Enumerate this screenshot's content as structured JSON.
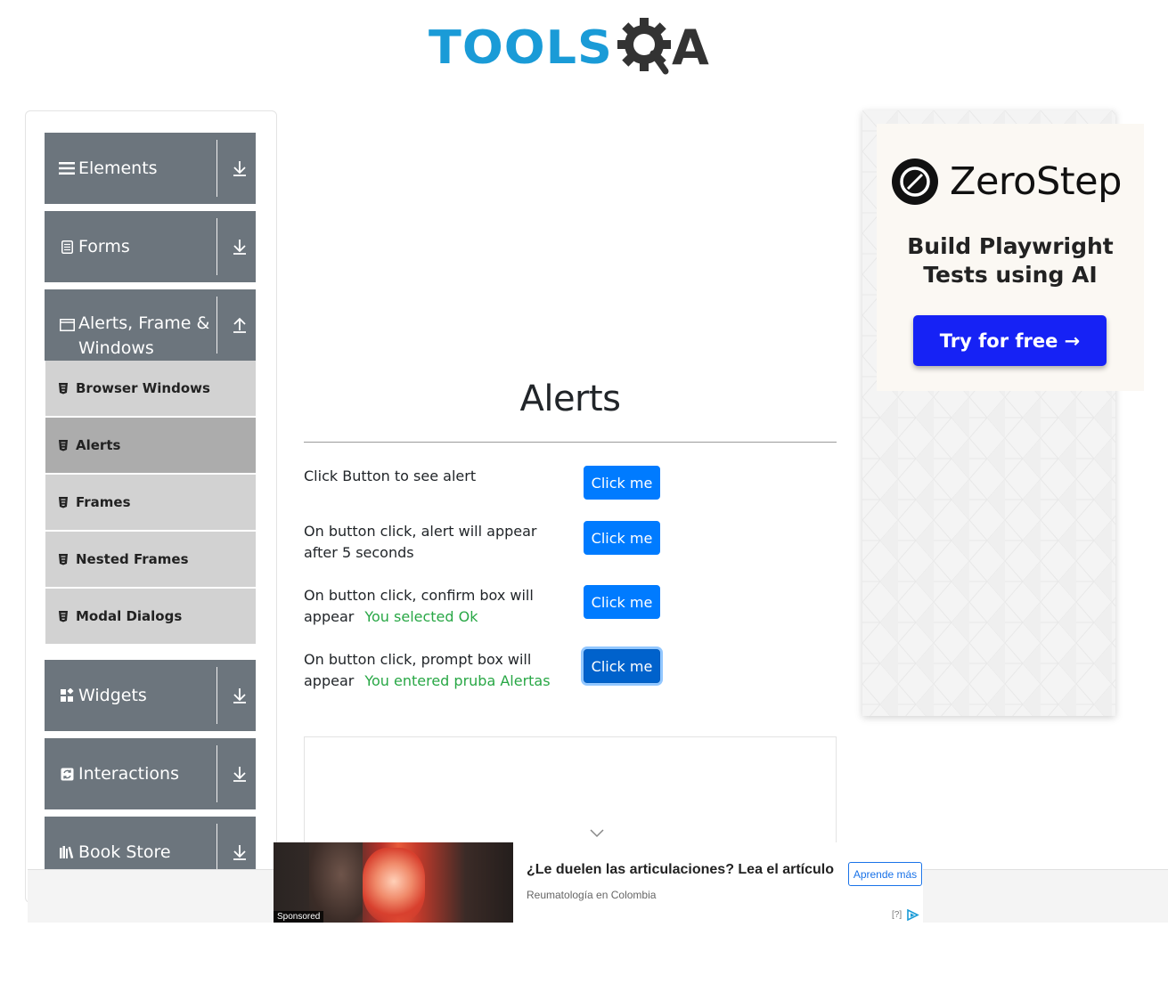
{
  "header": {
    "logo_text_part1": "TOOLS",
    "logo_text_part2": "A"
  },
  "sidebar": {
    "groups_top": [
      {
        "label": "Elements",
        "icon": "hamburger-icon",
        "arrow": "download-arrow-icon"
      },
      {
        "label": "Forms",
        "icon": "document-icon",
        "arrow": "download-arrow-icon"
      },
      {
        "label": "Alerts, Frame & Windows",
        "icon": "window-icon",
        "arrow": "upload-arrow-icon"
      }
    ],
    "items": [
      {
        "label": "Browser Windows",
        "active": false
      },
      {
        "label": "Alerts",
        "active": true
      },
      {
        "label": "Frames",
        "active": false
      },
      {
        "label": "Nested Frames",
        "active": false
      },
      {
        "label": "Modal Dialogs",
        "active": false
      }
    ],
    "groups_bottom": [
      {
        "label": "Widgets",
        "icon": "widgets-icon",
        "arrow": "download-arrow-icon"
      },
      {
        "label": "Interactions",
        "icon": "interactions-icon",
        "arrow": "download-arrow-icon"
      },
      {
        "label": "Book Store",
        "icon": "books-icon",
        "arrow": "download-arrow-icon"
      }
    ]
  },
  "main": {
    "title": "Alerts",
    "rows": [
      {
        "text": "Click Button to see alert",
        "result": "",
        "button": "Click me"
      },
      {
        "text": "On button click, alert will appear after 5 seconds",
        "result": "",
        "button": "Click me"
      },
      {
        "text_line1": "On button click, confirm box will",
        "text_line2": "appear",
        "result": "You selected Ok",
        "button": "Click me"
      },
      {
        "text_line1": "On button click, prompt box will",
        "text_line2": "appear",
        "result": "You entered pruba Alertas",
        "button": "Click me"
      }
    ]
  },
  "right_ad": {
    "brand": "ZeroStep",
    "tagline_line1": "Build Playwright",
    "tagline_line2": "Tests using AI",
    "cta": "Try for free →"
  },
  "sponsored_ad": {
    "tag": "Sponsored",
    "title": "¿Le duelen las articulaciones? Lea el artículo",
    "source": "Reumatología en Colombia",
    "cta": "Aprende más",
    "info": "[?]"
  },
  "colors": {
    "sidebar_group_bg": "#6c757d",
    "sidebar_item_bg": "#d2d2d2",
    "sidebar_item_active_bg": "#acacac",
    "primary_button": "#007bff",
    "success_text": "#28a745",
    "logo_blue": "#1a9bd7",
    "zerostep_button": "#1622f5"
  }
}
